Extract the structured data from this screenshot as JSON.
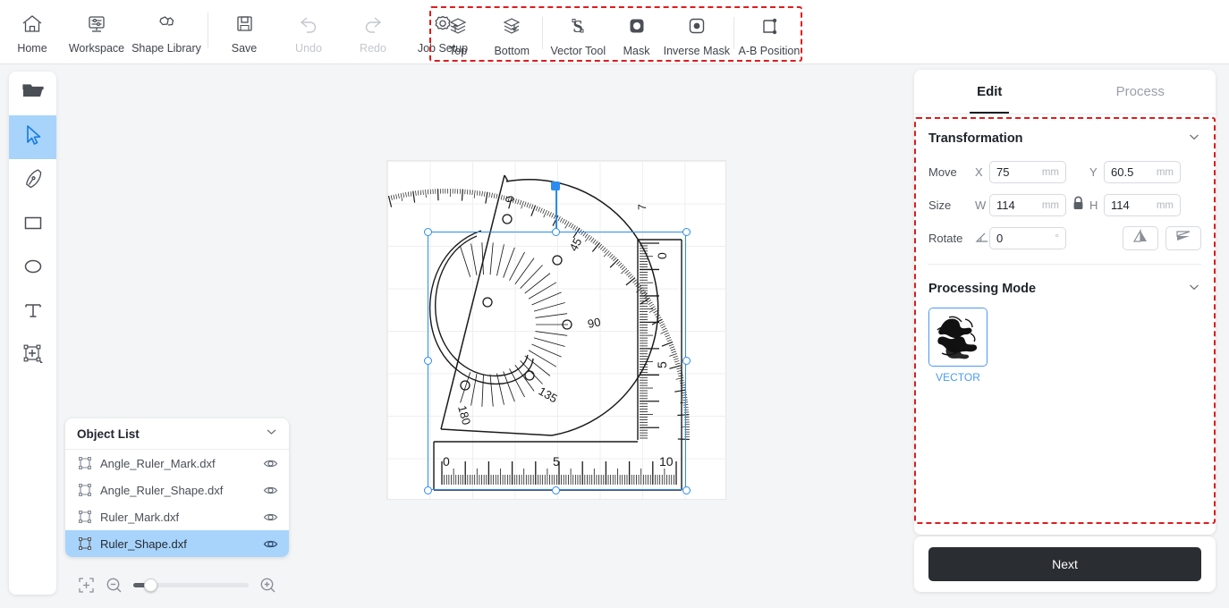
{
  "toolbar": {
    "main_items": [
      {
        "label": "Home",
        "icon": "home-icon",
        "disabled": false
      },
      {
        "label": "Workspace",
        "icon": "workspace-icon",
        "disabled": false
      },
      {
        "label": "Shape Library",
        "icon": "shape-library-icon",
        "disabled": false
      },
      {
        "label": "Save",
        "icon": "save-icon",
        "disabled": false
      },
      {
        "label": "Undo",
        "icon": "undo-icon",
        "disabled": true
      },
      {
        "label": "Redo",
        "icon": "redo-icon",
        "disabled": true
      },
      {
        "label": "Job Setup",
        "icon": "gear-icon",
        "disabled": false
      }
    ],
    "grouped_items": [
      {
        "label": "Top",
        "icon": "layer-up-icon"
      },
      {
        "label": "Bottom",
        "icon": "layer-down-icon"
      },
      {
        "label": "Vector Tool",
        "icon": "vector-tool-icon"
      },
      {
        "label": "Mask",
        "icon": "mask-icon"
      },
      {
        "label": "Inverse Mask",
        "icon": "inverse-mask-icon"
      },
      {
        "label": "A-B Position",
        "icon": "ab-position-icon"
      }
    ]
  },
  "left_rail": {
    "items": [
      {
        "name": "open-file-tool",
        "icon": "folder-icon",
        "active": false
      },
      {
        "name": "select-tool",
        "icon": "cursor-arrow-icon",
        "active": true
      },
      {
        "name": "pen-tool",
        "icon": "pen-nib-icon",
        "active": false
      },
      {
        "name": "rectangle-tool",
        "icon": "rectangle-icon",
        "active": false
      },
      {
        "name": "ellipse-tool",
        "icon": "ellipse-icon",
        "active": false
      },
      {
        "name": "text-tool",
        "icon": "text-t-icon",
        "active": false
      },
      {
        "name": "add-shape-tool",
        "icon": "add-frame-icon",
        "active": false
      }
    ]
  },
  "object_list": {
    "title": "Object List",
    "collapse_icon": "chevron-down-icon",
    "rows": [
      {
        "name": "Angle_Ruler_Mark.dxf",
        "selected": false,
        "visible": true
      },
      {
        "name": "Angle_Ruler_Shape.dxf",
        "selected": false,
        "visible": true
      },
      {
        "name": "Ruler_Mark.dxf",
        "selected": false,
        "visible": true
      },
      {
        "name": "Ruler_Shape.dxf",
        "selected": true,
        "visible": true
      }
    ]
  },
  "zoom_bar": {
    "fit_icon": "fit-to-screen-icon",
    "zoom_out_icon": "zoom-out-icon",
    "zoom_in_icon": "zoom-in-icon",
    "value_percent": 8
  },
  "right_panel": {
    "tabs": [
      {
        "label": "Edit",
        "active": true
      },
      {
        "label": "Process",
        "active": false
      }
    ],
    "transformation": {
      "title": "Transformation",
      "collapse_icon": "chevron-down-icon",
      "move": {
        "label": "Move",
        "x_axis": "X",
        "x_value": "75",
        "x_unit": "mm",
        "y_axis": "Y",
        "y_value": "60.5",
        "y_unit": "mm"
      },
      "size": {
        "label": "Size",
        "w_axis": "W",
        "w_value": "114",
        "w_unit": "mm",
        "lock_icon": "lock-closed-icon",
        "h_axis": "H",
        "h_value": "114",
        "h_unit": "mm"
      },
      "rotate": {
        "label": "Rotate",
        "angle_icon": "angle-icon",
        "value": "0",
        "unit": "°",
        "flip_horizontal_icon": "flip-horizontal-icon",
        "flip_vertical_icon": "flip-vertical-icon"
      }
    },
    "processing_mode": {
      "title": "Processing Mode",
      "collapse_icon": "chevron-down-icon",
      "modes": [
        {
          "label": "VECTOR",
          "selected": true
        }
      ]
    },
    "next_button": "Next"
  },
  "canvas": {
    "artwork_name": "protractor-and-ruler-drawing",
    "protractor_labels": [
      "0",
      "45",
      "90",
      "135",
      "180"
    ],
    "vertical_ruler_labels": [
      "0",
      "5"
    ],
    "horizontal_ruler_labels": [
      "0",
      "5",
      "10"
    ]
  },
  "colors": {
    "accent_blue": "#2b8cf0",
    "selection_fill": "#a8d4fb",
    "annotation_red": "#e01b1b",
    "next_button_bg": "#2a2d31",
    "panel_bg": "#ffffff",
    "app_bg": "#f4f5f7"
  }
}
